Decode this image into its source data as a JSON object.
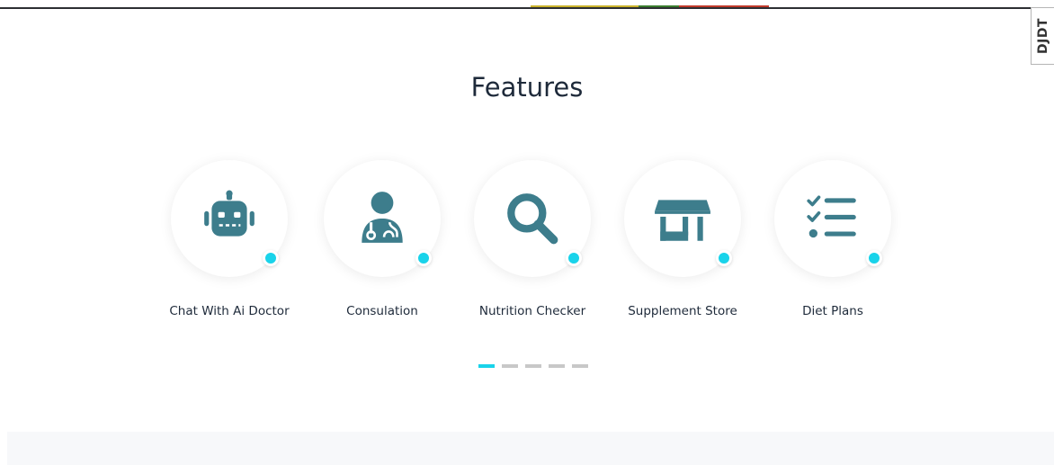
{
  "debug_toolbar": {
    "label": "DJDT"
  },
  "section": {
    "title": "Features"
  },
  "features": [
    {
      "label": "Chat With Ai Doctor",
      "icon": "robot-icon"
    },
    {
      "label": "Consulation",
      "icon": "doctor-icon"
    },
    {
      "label": "Nutrition Checker",
      "icon": "search-icon"
    },
    {
      "label": "Supplement Store",
      "icon": "store-icon"
    },
    {
      "label": "Diet Plans",
      "icon": "checklist-icon"
    }
  ],
  "pager": {
    "pages": 5,
    "active_index": 0
  },
  "colors": {
    "icon": "#3d7d8c",
    "accent": "#19d3ea",
    "title": "#1e2a3a",
    "pager_inactive": "#c8c8c8"
  }
}
